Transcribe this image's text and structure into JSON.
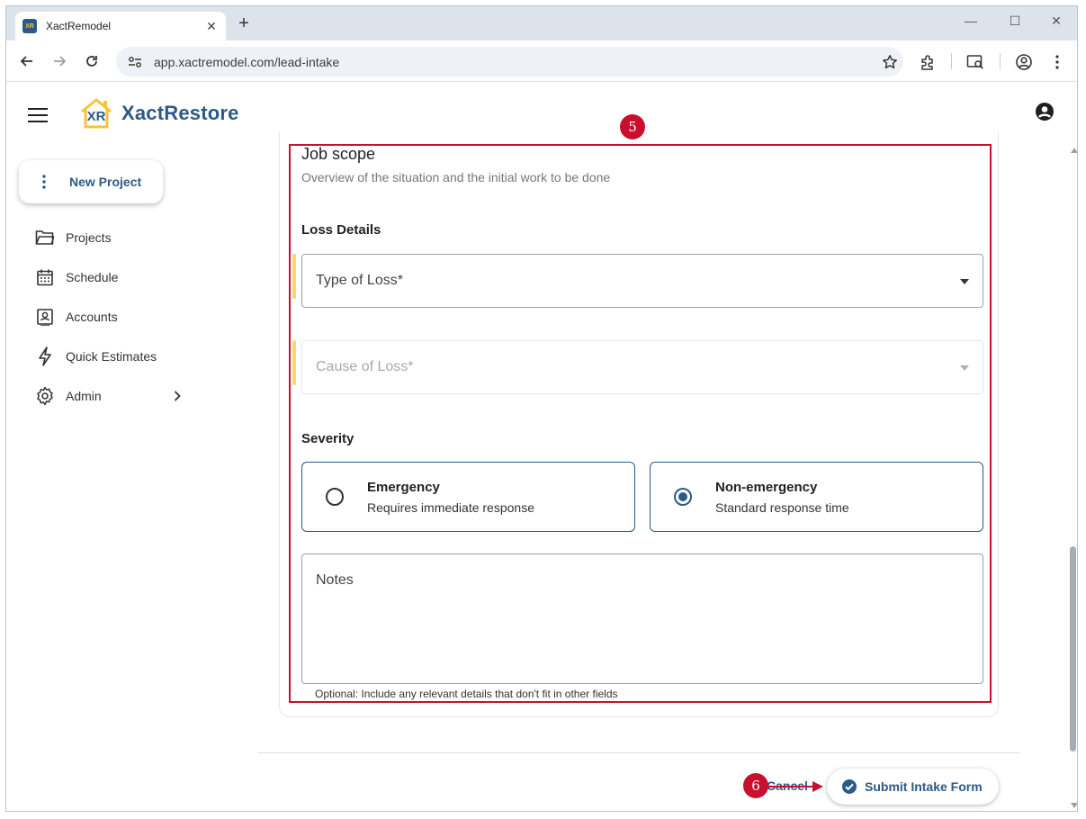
{
  "browser": {
    "tab_title": "XactRemodel",
    "url": "app.xactremodel.com/lead-intake"
  },
  "app": {
    "brand_name": "XactRestore",
    "logo_text": "XR",
    "new_project_label": "New Project",
    "nav": [
      {
        "label": "Projects",
        "icon": "folder-icon"
      },
      {
        "label": "Schedule",
        "icon": "calendar-icon"
      },
      {
        "label": "Accounts",
        "icon": "contact-card-icon"
      },
      {
        "label": "Quick Estimates",
        "icon": "lightning-icon"
      },
      {
        "label": "Admin",
        "icon": "gear-icon"
      }
    ]
  },
  "form": {
    "title": "Job scope",
    "subtitle": "Overview of the situation and the initial work to be done",
    "loss_details_heading": "Loss Details",
    "type_of_loss_label": "Type of Loss*",
    "cause_of_loss_label": "Cause of Loss*",
    "severity_heading": "Severity",
    "severity_options": [
      {
        "title": "Emergency",
        "description": "Requires immediate response",
        "selected": false
      },
      {
        "title": "Non-emergency",
        "description": "Standard response time",
        "selected": true
      }
    ],
    "notes_label": "Notes",
    "notes_hint": "Optional: Include any relevant details that don't fit in other fields"
  },
  "footer": {
    "cancel_label": "Cancel",
    "submit_label": "Submit Intake Form"
  },
  "annotations": {
    "badge_1": "5",
    "badge_2": "6"
  },
  "colors": {
    "brand": "#2c5a86",
    "logo_accent": "#f3c33b",
    "annotation_red": "#c8102e",
    "required_bar": "#f5d76b"
  }
}
